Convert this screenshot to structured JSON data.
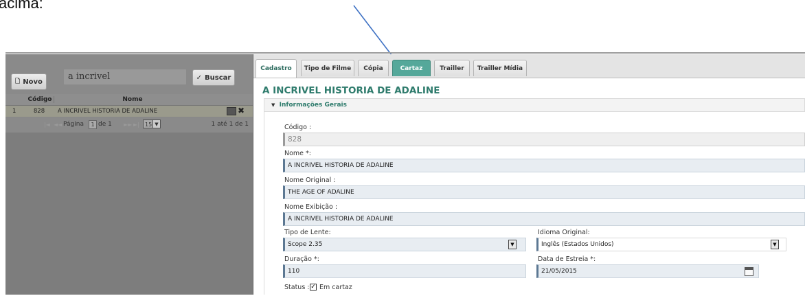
{
  "top_text": "acima:",
  "toolbar": {
    "novo_label": "Novo",
    "search_value": "a incrivel",
    "buscar_label": "Buscar"
  },
  "grid": {
    "columns": [
      "Código",
      "Nome"
    ],
    "rows": [
      {
        "num": "1",
        "codigo": "828",
        "nome": "A INCRIVEL HISTORIA DE ADALINE"
      }
    ],
    "pager": {
      "first": "|◄",
      "prev": "◄◄",
      "page_label": "Página",
      "page_value": "1",
      "of_label": "de 1",
      "next": "►►",
      "last": "►|",
      "page_size": "15",
      "total": "1 até 1 de 1"
    }
  },
  "tabs": [
    {
      "label": "Cadastro"
    },
    {
      "label": "Tipo de Filme"
    },
    {
      "label": "Cópia"
    },
    {
      "label": "Cartaz"
    },
    {
      "label": "Trailler"
    },
    {
      "label": "Trailler Mídia"
    }
  ],
  "form": {
    "title": "A INCRIVEL HISTORIA DE ADALINE",
    "section_label": "Informações Gerais",
    "codigo_label": "Código :",
    "codigo_value": "828",
    "nome_label": "Nome *:",
    "nome_value": "A INCRIVEL HISTORIA DE ADALINE",
    "nome_original_label": "Nome Original :",
    "nome_original_value": "THE AGE OF ADALINE",
    "nome_exibicao_label": "Nome Exibição :",
    "nome_exibicao_value": "A INCRIVEL HISTORIA DE ADALINE",
    "tipo_lente_label": "Tipo de Lente:",
    "tipo_lente_value": "Scope 2.35",
    "idioma_label": "Idioma Original:",
    "idioma_value": "Inglês (Estados Unidos)",
    "duracao_label": "Duração *:",
    "duracao_value": "110",
    "data_estreia_label": "Data de Estreia *:",
    "data_estreia_value": "21/05/2015",
    "status_label": "Status :",
    "status_checkbox_label": "Em cartaz"
  },
  "colors": {
    "active_tab": "#55a89a",
    "title": "#2e7b6c",
    "arrow": "#3f72c4"
  }
}
